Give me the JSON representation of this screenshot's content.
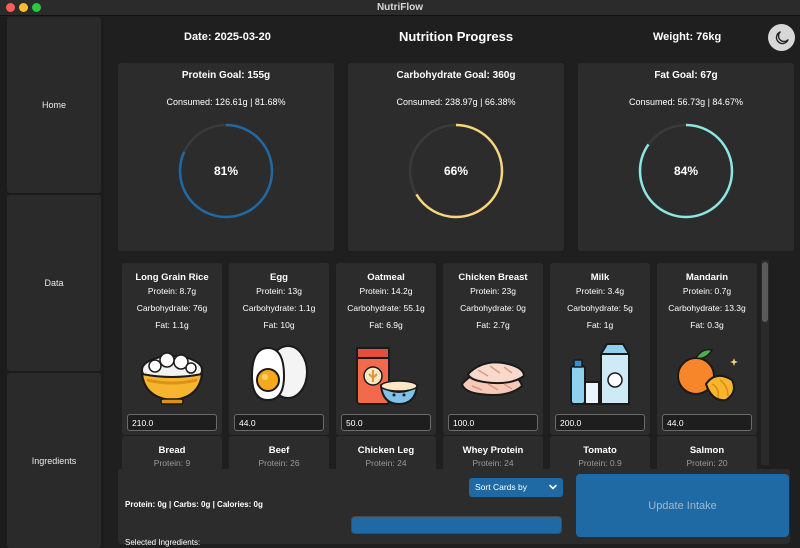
{
  "window": {
    "title": "NutriFlow"
  },
  "sidebar": {
    "items": [
      {
        "label": "Home"
      },
      {
        "label": "Data"
      },
      {
        "label": "Ingredients"
      }
    ]
  },
  "header": {
    "date": "Date: 2025-03-20",
    "title": "Nutrition Progress",
    "weight": "Weight: 76kg",
    "theme_icon": "moon-icon"
  },
  "goals": [
    {
      "title": "Protein Goal: 155g",
      "consumed": "Consumed: 126.61g | 81.68%",
      "percent_label": "81%",
      "fraction": 0.8168,
      "color": "#1f6aa5"
    },
    {
      "title": "Carbohydrate Goal: 360g",
      "consumed": "Consumed: 238.97g | 66.38%",
      "percent_label": "66%",
      "fraction": 0.6638,
      "color": "#f5d67b"
    },
    {
      "title": "Fat Goal: 67g",
      "consumed": "Consumed: 56.73g | 84.67%",
      "percent_label": "84%",
      "fraction": 0.8467,
      "color": "#8be7e3"
    }
  ],
  "ring_track_color": "#3a3a3a",
  "cards": [
    {
      "name": "Long Grain Rice",
      "protein": "Protein: 8.7g",
      "carbs": "Carbohydrate: 76g",
      "fat": "Fat: 1.1g",
      "amount": "210.0",
      "icon": "rice-bowl-icon"
    },
    {
      "name": "Egg",
      "protein": "Protein: 13g",
      "carbs": "Carbohydrate: 1.1g",
      "fat": "Fat: 10g",
      "amount": "44.0",
      "icon": "egg-icon"
    },
    {
      "name": "Oatmeal",
      "protein": "Protein: 14.2g",
      "carbs": "Carbohydrate: 55.1g",
      "fat": "Fat: 6.9g",
      "amount": "50.0",
      "icon": "oatmeal-icon"
    },
    {
      "name": "Chicken Breast",
      "protein": "Protein: 23g",
      "carbs": "Carbohydrate: 0g",
      "fat": "Fat: 2.7g",
      "amount": "100.0",
      "icon": "chicken-breast-icon"
    },
    {
      "name": "Milk",
      "protein": "Protein: 3.4g",
      "carbs": "Carbohydrate: 5g",
      "fat": "Fat: 1g",
      "amount": "200.0",
      "icon": "milk-icon"
    },
    {
      "name": "Mandarin",
      "protein": "Protein: 0.7g",
      "carbs": "Carbohydrate: 13.3g",
      "fat": "Fat: 0.3g",
      "amount": "44.0",
      "icon": "mandarin-icon"
    }
  ],
  "cards_row2": [
    {
      "name": "Bread",
      "protein": "Protein: 9"
    },
    {
      "name": "Beef",
      "protein": "Protein: 26"
    },
    {
      "name": "Chicken Leg",
      "protein": "Protein: 24"
    },
    {
      "name": "Whey Protein",
      "protein": "Protein: 24"
    },
    {
      "name": "Tomato",
      "protein": "Protein: 0.9"
    },
    {
      "name": "Salmon",
      "protein": "Protein: 20"
    }
  ],
  "bottom": {
    "summary": "Protein: 0g | Carbs: 0g | Calories: 0g",
    "sort_label": "Sort Cards by",
    "selected_label": "Selected Ingredients:",
    "update_label": "Update Intake"
  },
  "accent_color": "#1f6aa5"
}
